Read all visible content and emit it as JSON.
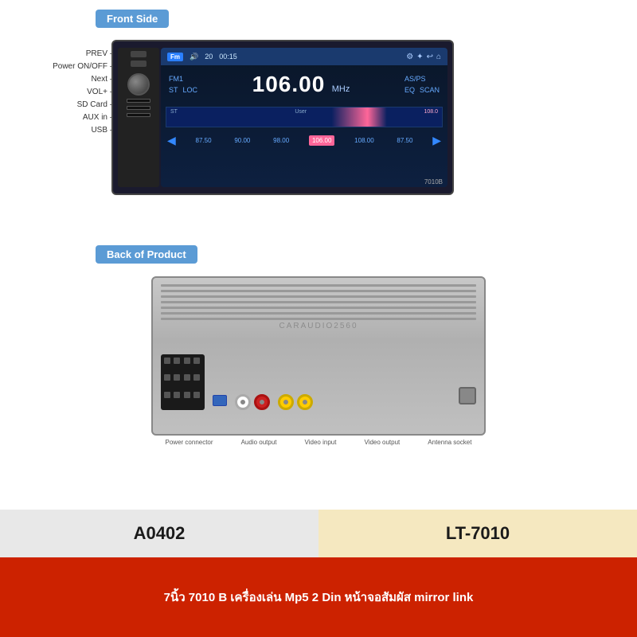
{
  "front_section": {
    "label": "Front Side",
    "labels": [
      {
        "text": "PREV"
      },
      {
        "text": "Power ON/OFF"
      },
      {
        "text": "Next"
      },
      {
        "text": "VOL+"
      },
      {
        "text": "SD Card"
      },
      {
        "text": "AUX in"
      },
      {
        "text": "USB"
      }
    ],
    "screen": {
      "source": "Fm",
      "volume": "20",
      "time": "00:15",
      "station": "FM1",
      "frequency": "106.00",
      "unit": "MHz",
      "mode_right": "AS/PS",
      "eq": "EQ",
      "scan": "SCAN",
      "st": "ST",
      "loc": "LOC",
      "user": "User",
      "freq_marks": [
        "87.50",
        "90.00",
        "98.00",
        "106.00",
        "108.00",
        "87.50"
      ],
      "model_tag": "7010B"
    }
  },
  "back_section": {
    "label": "Back of Product",
    "watermark": "CARAUDIO2560",
    "ports": [
      {
        "label": "Power connector"
      },
      {
        "label": "Audio output"
      },
      {
        "label": "Video input"
      },
      {
        "label": "Video output"
      },
      {
        "label": "Antenna socket"
      }
    ]
  },
  "bottom": {
    "code": "A0402",
    "model": "LT-7010",
    "description": "7นิ้ว 7010 B เครื่องเล่น Mp5 2 Din หน้าจอสัมผัส mirror link"
  }
}
